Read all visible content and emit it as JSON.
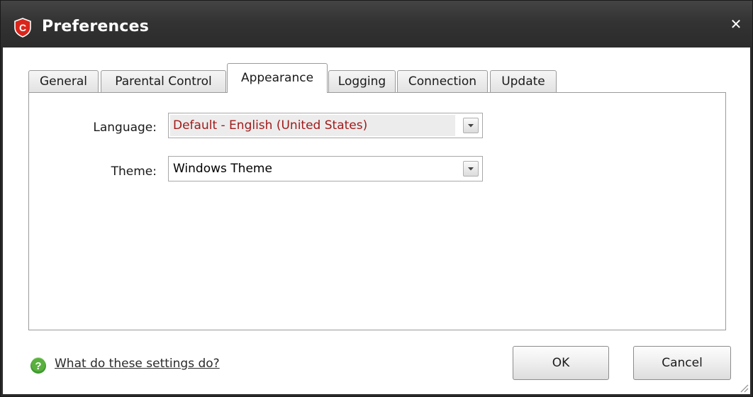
{
  "window": {
    "title": "Preferences",
    "close_glyph": "✕",
    "app_icon": "comodo-c-logo-icon",
    "accent_color": "#d9261c"
  },
  "tabs": [
    {
      "label": "General",
      "active": false
    },
    {
      "label": "Parental Control",
      "active": false
    },
    {
      "label": "Appearance",
      "active": true
    },
    {
      "label": "Logging",
      "active": false
    },
    {
      "label": "Connection",
      "active": false
    },
    {
      "label": "Update",
      "active": false
    }
  ],
  "appearance": {
    "language": {
      "label": "Language:",
      "value": "Default - English (United States)",
      "value_color": "#a11a1a"
    },
    "theme": {
      "label": "Theme:",
      "value": "Windows Theme"
    }
  },
  "footer": {
    "help_icon": "question-mark-icon",
    "help_link": "What do these settings do?",
    "ok_label": "OK",
    "cancel_label": "Cancel"
  }
}
